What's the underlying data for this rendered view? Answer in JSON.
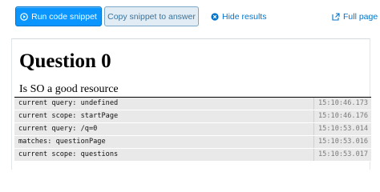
{
  "toolbar": {
    "run_label": "Run code snippet",
    "copy_label": "Copy snippet to answer",
    "hide_label": "Hide results",
    "full_label": "Full page",
    "accent": "#0a95ff"
  },
  "result": {
    "heading": "Question 0",
    "paragraph": "Is SO a good resource"
  },
  "console": {
    "rows": [
      {
        "message": "current query: undefined",
        "time": "15:10:46.173"
      },
      {
        "message": "current scope: startPage",
        "time": "15:10:46.176"
      },
      {
        "message": "current query: /q=0",
        "time": "15:10:53.014"
      },
      {
        "message": "matches: questionPage",
        "time": "15:10:53.016"
      },
      {
        "message": "current scope: questions",
        "time": "15:10:53.017"
      }
    ]
  },
  "icons": {
    "run": "play-circle-icon",
    "hide": "close-circle-icon",
    "full": "external-link-icon"
  }
}
